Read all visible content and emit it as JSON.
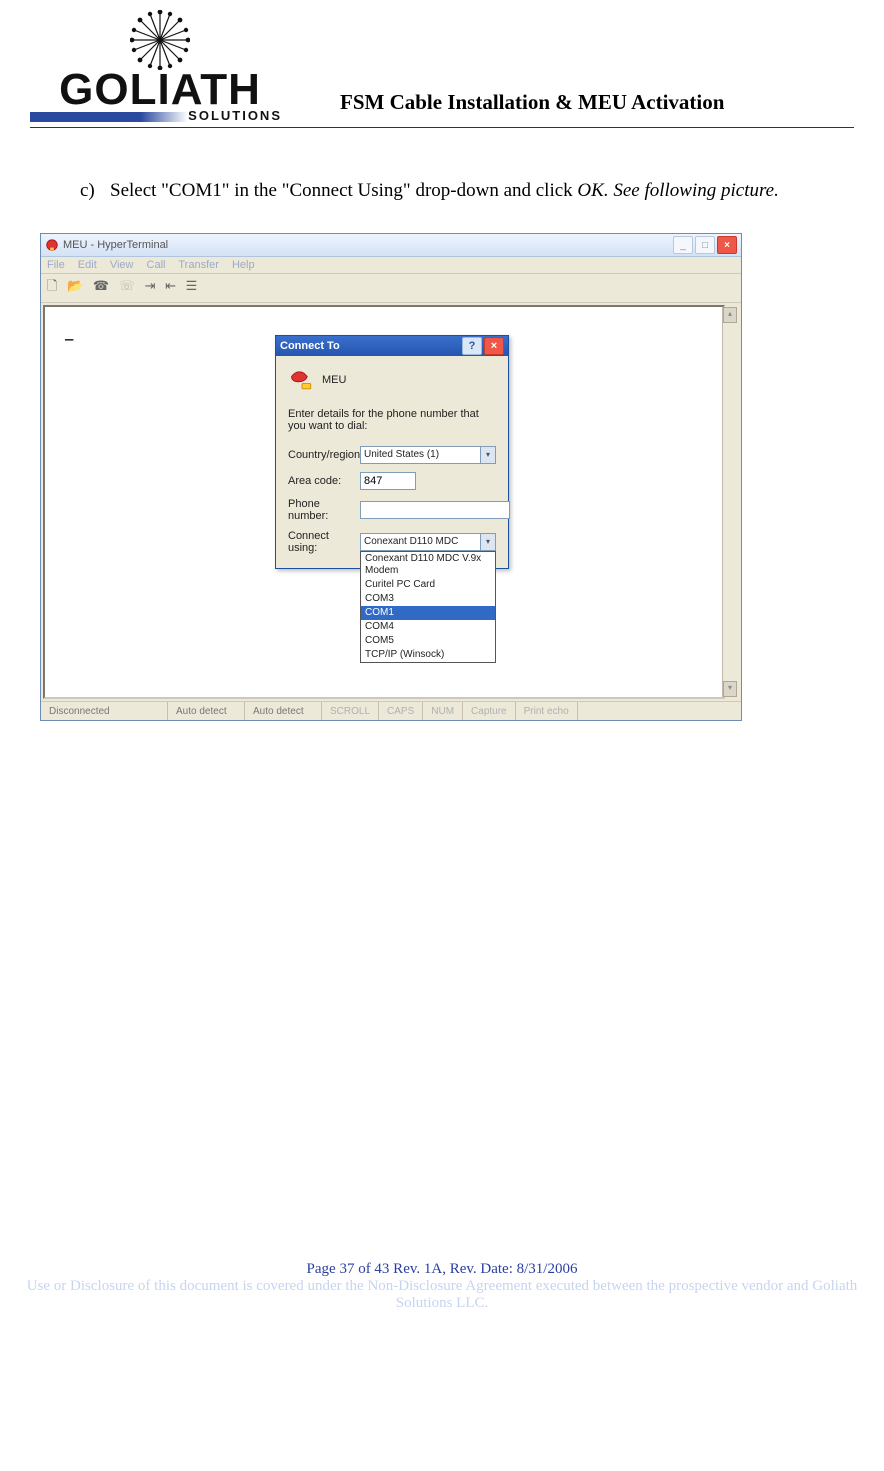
{
  "header": {
    "logo_main": "GOLIATH",
    "logo_sub": "SOLUTIONS",
    "doc_title": "FSM Cable Installation & MEU Activation"
  },
  "instruction": {
    "marker": "c)",
    "text_a": "Select \"COM1\" in the \"Connect Using\" drop-down and click ",
    "ok": "OK.",
    "text_b": "  See following picture."
  },
  "ht": {
    "title": "MEU - HyperTerminal",
    "menus": [
      "File",
      "Edit",
      "View",
      "Call",
      "Transfer",
      "Help"
    ],
    "cursor": "_",
    "status": {
      "conn": "Disconnected",
      "det1": "Auto detect",
      "det2": "Auto detect",
      "scroll": "SCROLL",
      "caps": "CAPS",
      "num": "NUM",
      "capture": "Capture",
      "echo": "Print echo"
    }
  },
  "dialog": {
    "title": "Connect To",
    "conn_name": "MEU",
    "hint": "Enter details for the phone number that you want to dial:",
    "labels": {
      "country": "Country/region:",
      "area": "Area code:",
      "phone": "Phone number:",
      "connect": "Connect using:"
    },
    "values": {
      "country": "United States (1)",
      "area": "847",
      "phone": "",
      "connect": "Conexant D110 MDC V.9x Modem"
    },
    "options": [
      "Conexant D110 MDC V.9x Modem",
      "Curitel PC Card",
      "COM3",
      "COM1",
      "COM4",
      "COM5",
      "TCP/IP (Winsock)"
    ],
    "selected_index": 3
  },
  "footer": {
    "line1": "Page 37 of 43     Rev. 1A,   Rev. Date: 8/31/2006",
    "line2": "Use or Disclosure of this document is covered under the Non-Disclosure Agreement executed between the prospective vendor and Goliath Solutions LLC."
  }
}
